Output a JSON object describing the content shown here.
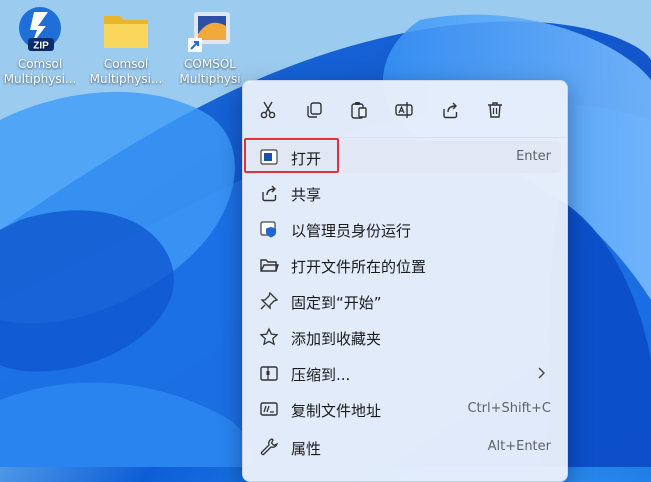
{
  "desktop_icons": [
    {
      "line1": "Comsol",
      "line2": "Multiphysi...",
      "badge": "ZIP",
      "icon": "zip-archive-icon"
    },
    {
      "line1": "Comsol",
      "line2": "Multiphysi...",
      "icon": "folder-icon"
    },
    {
      "line1": "COMSOL",
      "line2": "Multiphysi",
      "icon": "app-shortcut-icon"
    }
  ],
  "toolbar": [
    "cut-icon",
    "copy-icon",
    "paste-icon",
    "rename-icon",
    "share-icon",
    "delete-icon"
  ],
  "menu_items": [
    {
      "label": "打开",
      "shortcut": "Enter",
      "icon": "open-icon"
    },
    {
      "label": "共享",
      "icon": "share-icon"
    },
    {
      "label": "以管理员身份运行",
      "icon": "admin-shield-icon"
    },
    {
      "label": "打开文件所在的位置",
      "icon": "folder-open-icon"
    },
    {
      "label": "固定到“开始”",
      "icon": "pin-icon"
    },
    {
      "label": "添加到收藏夹",
      "icon": "star-icon"
    },
    {
      "label": "压缩到...",
      "icon": "compress-icon",
      "submenu": true
    },
    {
      "label": "复制文件地址",
      "shortcut": "Ctrl+Shift+C",
      "icon": "copy-path-icon"
    },
    {
      "label": "属性",
      "shortcut": "Alt+Enter",
      "icon": "wrench-icon"
    }
  ],
  "colors": {
    "accent": "#0067c0",
    "highlight_box": "#e0323a"
  }
}
